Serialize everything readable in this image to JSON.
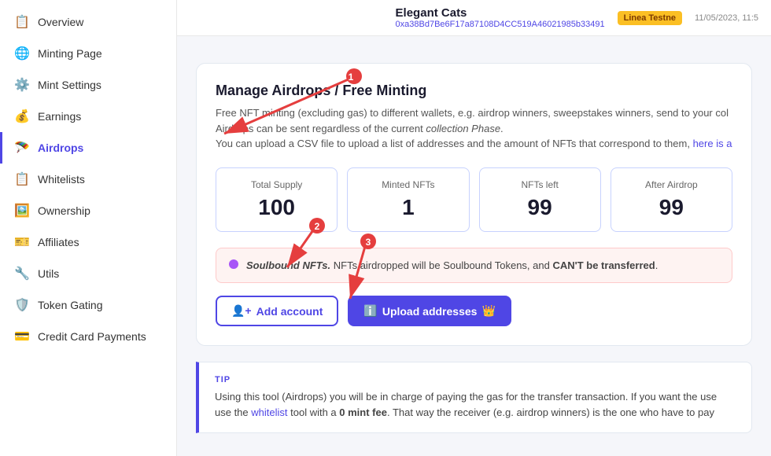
{
  "sidebar": {
    "items": [
      {
        "id": "overview",
        "label": "Overview",
        "icon": "📋",
        "active": false
      },
      {
        "id": "minting-page",
        "label": "Minting Page",
        "icon": "🌐",
        "active": false
      },
      {
        "id": "mint-settings",
        "label": "Mint Settings",
        "icon": "⚙️",
        "active": false
      },
      {
        "id": "earnings",
        "label": "Earnings",
        "icon": "💰",
        "active": false
      },
      {
        "id": "airdrops",
        "label": "Airdrops",
        "icon": "🪂",
        "active": true
      },
      {
        "id": "whitelists",
        "label": "Whitelists",
        "icon": "📋",
        "active": false
      },
      {
        "id": "ownership",
        "label": "Ownership",
        "icon": "🖼️",
        "active": false
      },
      {
        "id": "affiliates",
        "label": "Affiliates",
        "icon": "🎫",
        "active": false
      },
      {
        "id": "utils",
        "label": "Utils",
        "icon": "🔧",
        "active": false
      },
      {
        "id": "token-gating",
        "label": "Token Gating",
        "icon": "🛡️",
        "active": false
      },
      {
        "id": "credit-card",
        "label": "Credit Card Payments",
        "icon": "💳",
        "active": false
      }
    ]
  },
  "header": {
    "collection_name": "Elegant Cats",
    "collection_address": "0xa38Bd7Be6F17a87108D4CC519A46021985b33491",
    "network": "Linea Testne",
    "timestamp": "11/05/2023, 11:5"
  },
  "manage": {
    "title": "Manage Airdrops / Free Minting",
    "desc1": "Free NFT minting (excluding gas) to different wallets, e.g. airdrop winners, sweepstakes winners, send to your col",
    "desc2": "Airdrops can be sent regardless of the current ",
    "desc_italic": "collection Phase",
    "desc3": ".",
    "desc4": "You can upload a CSV file to upload a list of addresses and the amount of NFTs that correspond to them, ",
    "desc_link": "here is a"
  },
  "stats": [
    {
      "label": "Total Supply",
      "value": "100"
    },
    {
      "label": "Minted NFTs",
      "value": "1"
    },
    {
      "label": "NFTs left",
      "value": "99"
    },
    {
      "label": "After Airdrop",
      "value": "99"
    }
  ],
  "soulbound": {
    "italic_label": "Soulbound NFTs.",
    "text": "NFTs airdropped will be Soulbound Tokens, and ",
    "bold": "CAN'T be transferred",
    "text2": "."
  },
  "buttons": {
    "add_account": "Add account",
    "upload_addresses": "Upload addresses"
  },
  "tip": {
    "label": "TIP",
    "text": "Using this tool (Airdrops) you will be in charge of paying the gas for the transfer transaction. If you want the use",
    "text2": "use the ",
    "link": "whitelist",
    "text3": " tool with a ",
    "bold": "0 mint fee",
    "text4": ". That way the receiver (e.g. airdrop winners) is the one who have to pay"
  },
  "annotations": {
    "arrow1_label": "1",
    "arrow2_label": "2",
    "arrow3_label": "3"
  }
}
